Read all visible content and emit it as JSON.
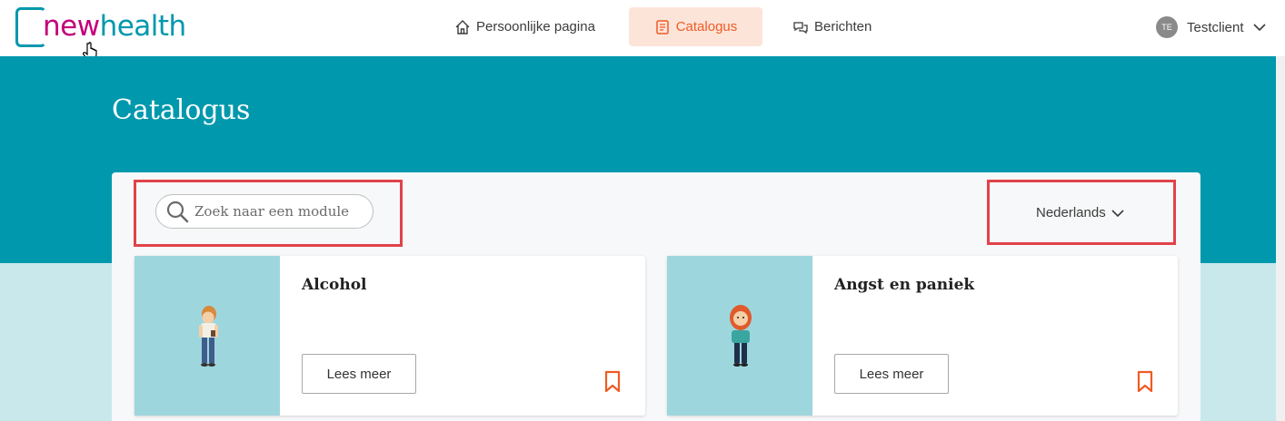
{
  "header": {
    "logo": {
      "part1": "new",
      "part2": "health"
    },
    "nav": [
      {
        "label": "Persoonlijke pagina",
        "icon": "home-icon",
        "active": false
      },
      {
        "label": "Catalogus",
        "icon": "book-icon",
        "active": true
      },
      {
        "label": "Berichten",
        "icon": "chat-icon",
        "active": false
      }
    ],
    "user": {
      "initials": "TE",
      "name": "Testclient"
    }
  },
  "page": {
    "title": "Catalogus"
  },
  "search": {
    "placeholder": "Zoek naar een module",
    "value": ""
  },
  "language": {
    "selected": "Nederlands"
  },
  "modules": [
    {
      "title": "Alcohol",
      "button": "Lees meer"
    },
    {
      "title": "Angst en paniek",
      "button": "Lees meer"
    }
  ],
  "colors": {
    "teal": "#0098ad",
    "magenta": "#c4007a",
    "accent": "#ef5b25",
    "highlight": "#e0434a"
  }
}
